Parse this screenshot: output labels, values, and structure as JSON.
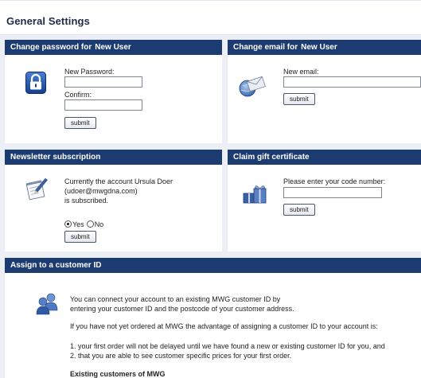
{
  "page": {
    "title": "General Settings"
  },
  "user_name": "New User",
  "change_password": {
    "header": "Change password for",
    "new_password_label": "New Password:",
    "new_password_value": "",
    "confirm_label": "Confirm:",
    "confirm_value": "",
    "submit_label": "submit",
    "icon": "lock-icon"
  },
  "change_email": {
    "header": "Change email for",
    "new_email_label": "New email:",
    "new_email_value": "",
    "submit_label": "submit",
    "icon": "email-envelope-globe-icon"
  },
  "newsletter": {
    "header": "Newsletter subscription",
    "line1": "Currently the account Ursula Doer",
    "line2": "(udoer@mwgdna.com)",
    "line3": "is subscribed.",
    "option_yes": "Yes",
    "option_no": "No",
    "selected": "Yes",
    "submit_label": "submit",
    "icon": "notepad-pencil-icon"
  },
  "gift_certificate": {
    "header": "Claim gift certificate",
    "code_label": "Please enter your code number:",
    "code_value": "",
    "submit_label": "submit",
    "icon": "gift-icon"
  },
  "customer_id": {
    "header": "Assign to a customer ID",
    "intro_line1": "You can connect your account to an existing MWG customer ID by",
    "intro_line2": "entering your customer ID and the postcode of your customer address.",
    "advantage": "If you have not yet ordered at MWG the advantage of assigning a customer ID to your account is:",
    "point1": "1. your first order will not be delayed until we have found a new or existing customer ID for you, and",
    "point2": "2. that you are able to see customer specific prices for your first order.",
    "existing_heading": "Existing customers of MWG",
    "icon": "users-group-icon"
  },
  "colors": {
    "header_bar": "#1c3b71",
    "content_background": "#eceff5",
    "panel_background": "#ffffff",
    "title_text": "#1f2a44"
  }
}
